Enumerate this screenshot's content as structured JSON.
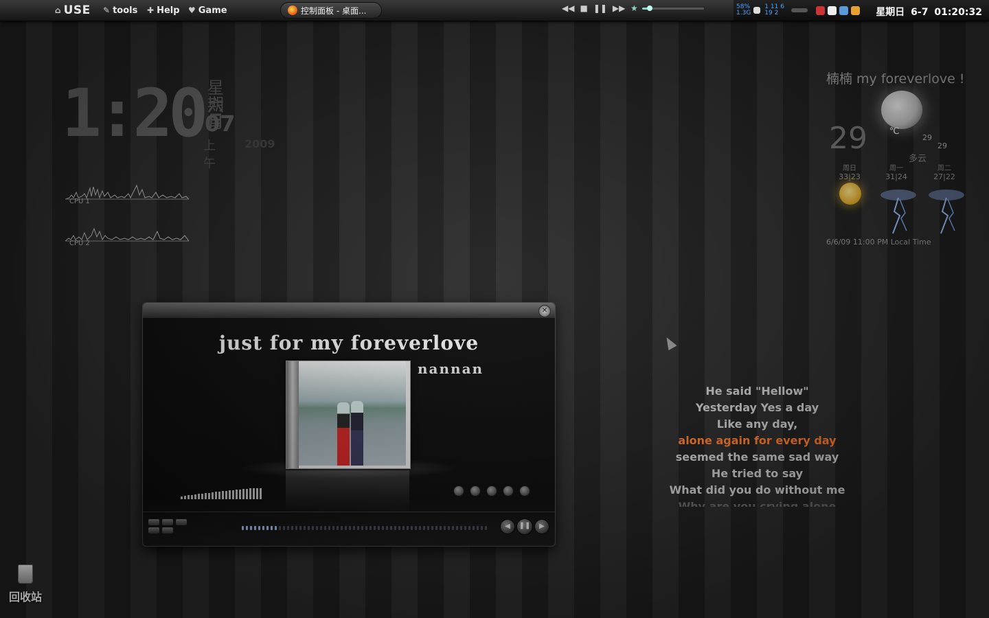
{
  "topbar": {
    "menu": [
      {
        "label": "USE",
        "icon": "home-icon"
      },
      {
        "label": "tools",
        "icon": "wrench-icon"
      },
      {
        "label": "Help",
        "icon": "plus-icon"
      },
      {
        "label": "Game",
        "icon": "heart-icon"
      }
    ],
    "task_title": "控制面板 - 桌面...",
    "task_icon": "firefox-icon",
    "transport_icons": [
      "rewind-icon",
      "stop-icon",
      "pause-icon",
      "forward-icon"
    ],
    "volume_level": 0.12,
    "net_up": "58%",
    "net_down": "1.3G",
    "net_stat_a": "1 11",
    "net_stat_b": "6",
    "net_stat_c": "19",
    "net_stat_d": "2",
    "clock_text": "星期日  6-7  01:20:32"
  },
  "desktop_clock": {
    "time": "1:20",
    "weekday": "星期日",
    "month": "六月",
    "day": "07",
    "ampm": "上午",
    "year": "2009"
  },
  "cpu": [
    {
      "label": "CPU 1"
    },
    {
      "label": "CPU 2"
    }
  ],
  "weather": {
    "title": "楠楠 my foreverlove !",
    "temp": "29",
    "unit": "℃",
    "hi": "29",
    "lo": "29",
    "condition": "多云",
    "forecast": [
      {
        "day": "周日",
        "temps": "33|23"
      },
      {
        "day": "周一",
        "temps": "31|24"
      },
      {
        "day": "周二",
        "temps": "27|22"
      }
    ],
    "updated": "6/6/09 11:00 PM Local Time"
  },
  "player": {
    "title": "just for my foreverlove",
    "artist": "nannan",
    "progress_fraction": 0.15
  },
  "lyrics": {
    "lines": [
      "He said \"Hellow\"",
      "Yesterday Yes a day",
      "Like any day,",
      "alone again for every day",
      "seemed the same sad way",
      "He tried to say",
      "What did you do without me",
      "Why are you crying alone"
    ],
    "highlight_index": 3
  },
  "recycle_bin": {
    "label": "回收站"
  }
}
